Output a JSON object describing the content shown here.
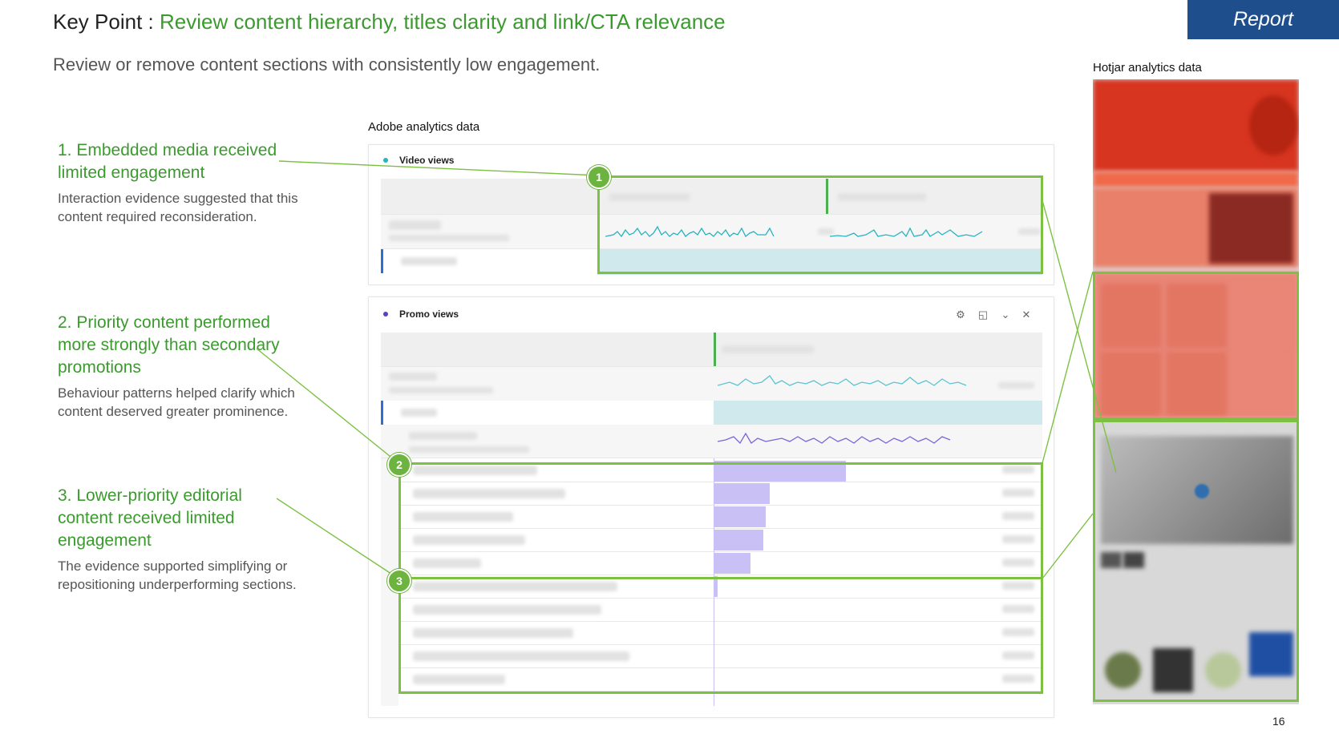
{
  "header": {
    "key_point_label": "Key Point : ",
    "key_point_text": "Review content hierarchy, titles clarity and link/CTA relevance",
    "subtitle": "Review or remove content sections with consistently low engagement.",
    "report_tab": "Report"
  },
  "points": [
    {
      "title": "1. Embedded media received limited engagement",
      "body": "Interaction evidence suggested that this content required reconsideration."
    },
    {
      "title": "2. Priority content performed more strongly than secondary promotions",
      "body": "Behaviour patterns helped clarify which content deserved greater prominence."
    },
    {
      "title": "3. Lower-priority editorial content received limited engagement",
      "body": "The evidence supported simplifying or repositioning underperforming sections."
    }
  ],
  "adobe": {
    "label": "Adobe analytics data",
    "video_panel_title": "Video views",
    "promo_panel_title": "Promo views"
  },
  "hotjar": {
    "label": "Hotjar analytics data"
  },
  "markers": [
    "1",
    "2",
    "3"
  ],
  "page_number": "16",
  "colors": {
    "accent_green": "#3b9a2e",
    "highlight_green": "#7cc142",
    "report_blue": "#1f4e8c",
    "bar_purple": "#c9c0f5",
    "row_teal": "#cfe9ec"
  }
}
